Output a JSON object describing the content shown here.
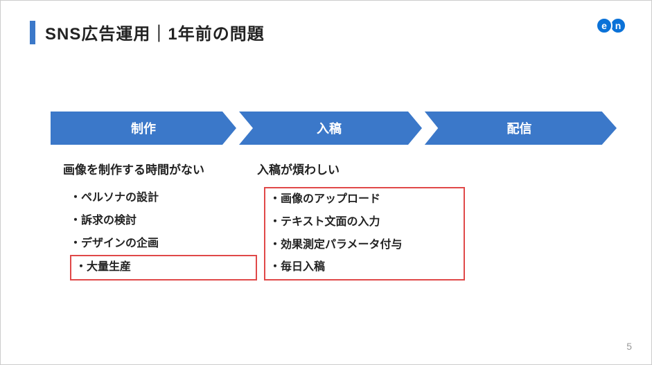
{
  "title": "SNS広告運用｜1年前の問題",
  "logo": {
    "left": "e",
    "right": "n"
  },
  "flow": {
    "step1": "制作",
    "step2": "入稿",
    "step3": "配信"
  },
  "columns": {
    "col1": {
      "heading": "画像を制作する時間がない",
      "items": [
        "・ペルソナの設計",
        "・訴求の検討",
        "・デザインの企画"
      ],
      "highlighted": [
        "・大量生産"
      ]
    },
    "col2": {
      "heading": "入稿が煩わしい",
      "highlighted": [
        "・画像のアップロード",
        "・テキスト文面の入力",
        "・効果測定パラメータ付与",
        "・毎日入稿"
      ]
    }
  },
  "page_number": "5",
  "colors": {
    "accent": "#3b78c9",
    "highlight": "#e04848"
  }
}
